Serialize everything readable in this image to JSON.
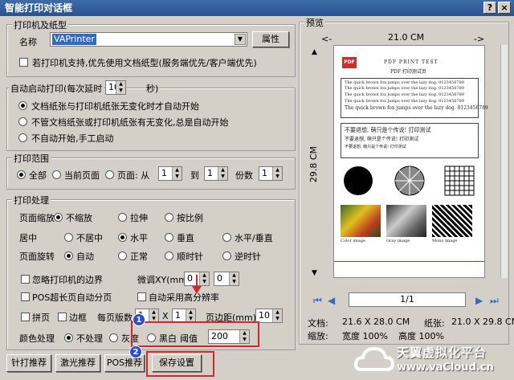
{
  "window": {
    "title": "智能打印对话框",
    "help": "?",
    "close": "×"
  },
  "printer": {
    "legend": "打印机及纸型",
    "name_label": "名称",
    "name_value": "VAPrinter",
    "props_button": "属性",
    "use_doc_paper": "若打印机支持,优先使用文档纸型(服务端优先/客户端优先)"
  },
  "autostart": {
    "legend": "自动启动打印(每次延时",
    "delay": "10",
    "sec": "秒)",
    "opt1": "文档纸张与打印机纸张无变化时才自动开始",
    "opt2": "不管文档纸张或打印机纸张有无变化,总是自动开始",
    "opt3": "不自动开始,手工启动"
  },
  "range": {
    "legend": "打印范围",
    "all": "全部",
    "current": "当前页面",
    "pages": "页面: 从",
    "from": "1",
    "to_label": "到",
    "to": "1",
    "copies_label": "份数",
    "copies": "1"
  },
  "processing": {
    "legend": "打印处理",
    "scale_label": "页面缩放",
    "scale_none": "不缩放",
    "scale_stretch": "拉伸",
    "scale_ratio": "按比例",
    "center_label": "居中",
    "center_none": "不居中",
    "center_h": "水平",
    "center_v": "垂直",
    "center_hv": "水平/垂直",
    "rotate_label": "页面旋转",
    "rotate_auto": "自动",
    "rotate_normal": "正常",
    "rotate_cw": "顺时针",
    "rotate_ccw": "逆时针",
    "ignore_margin": "忽略打印机的边界",
    "offset_label": "微调XY(mm)",
    "offset_x": "0",
    "offset_y": "0",
    "pos_split": "POS超长页自动分页",
    "high_res": "自动采用高分辨率",
    "tile": "拼页",
    "border": "边框",
    "per_page": "每页版数",
    "cols": "1",
    "x": "X",
    "rows": "1",
    "margin_label": "页边距(mm)",
    "margin": "10",
    "color_label": "颜色处理",
    "color_none": "不处理",
    "color_gray": "灰度",
    "color_bw": "黑白",
    "threshold_label": "阈值",
    "threshold": "200"
  },
  "buttons": {
    "needle": "针打推荐",
    "laser": "激光推荐",
    "pos": "POS推荐",
    "save": "保存设置"
  },
  "badges": {
    "one": "1",
    "two": "2"
  },
  "preview": {
    "legend": "预览",
    "width": "21.0 CM",
    "height": "29.8 CM",
    "left_arrow": "<-",
    "right_arrow": "->",
    "page": "1/1",
    "doc_label": "文档:",
    "doc_size": "21.6 X 28.0 CM",
    "paper_label": "纸张:",
    "paper_size": "21.0 X 29.8 CM",
    "zoom_label": "缩放:",
    "zoom_w": "宽度 100%",
    "zoom_h": "高度 100%",
    "thumb_title": "PDF PRINT TEST",
    "thumb_sub": "PDF 打印测试页",
    "fox": "The quick brown fox jumps over the lazy dog. 0123456789",
    "cn_line": "不要退想, 萌只是个传说!   打印测试",
    "cn_line2": "不要退想, 萌只是个传说!   打印测试",
    "img1": "Color image",
    "img2": "Gray image",
    "img3": "Mono image"
  },
  "watermark": {
    "cn": "天翼虚拟化平台",
    "en": "www.vaCloud.cn"
  },
  "colors": {
    "title": "#2a5290",
    "red": "#d0282c",
    "badge": "#2a4fd6"
  }
}
